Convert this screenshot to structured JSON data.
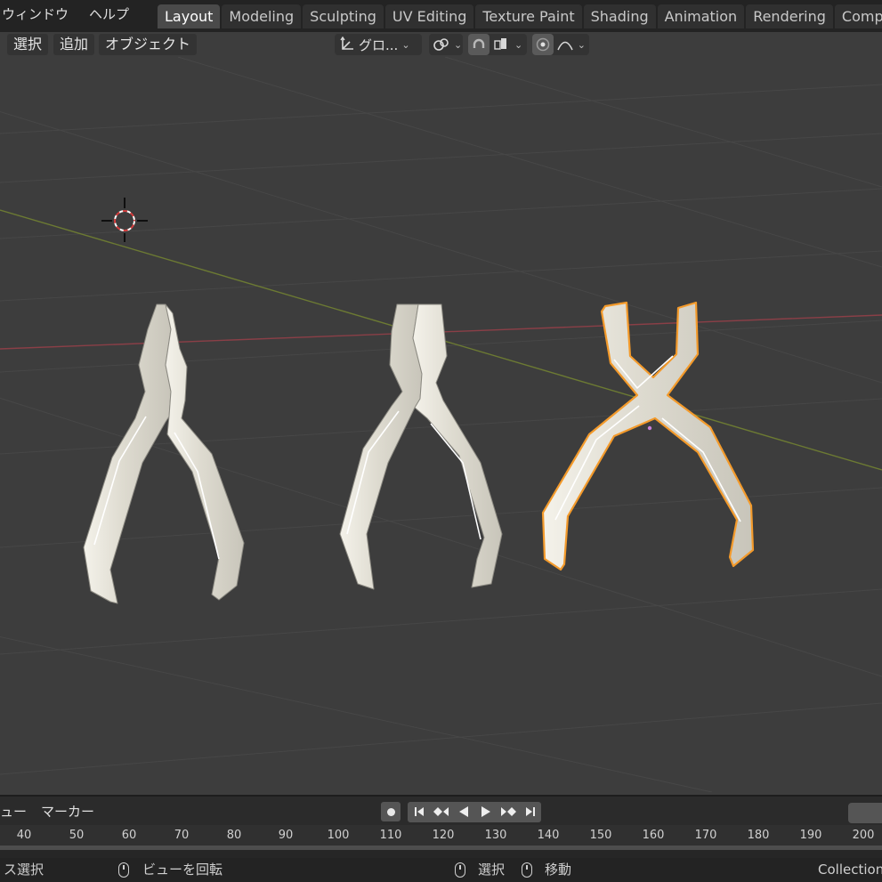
{
  "top_menu": {
    "window": "ウィンドウ",
    "help": "ヘルプ"
  },
  "tabs": [
    "Layout",
    "Modeling",
    "Sculpting",
    "UV Editing",
    "Texture Paint",
    "Shading",
    "Animation",
    "Rendering",
    "Compo"
  ],
  "active_tab": "Layout",
  "header": {
    "select": "選択",
    "add": "追加",
    "object": "オブジェクト",
    "transform_orientation": "グロ..."
  },
  "timeline": {
    "view_menu": "ュー",
    "marker_menu": "マーカー",
    "frame_ticks": [
      "40",
      "50",
      "60",
      "70",
      "80",
      "90",
      "100",
      "110",
      "120",
      "130",
      "140",
      "150",
      "160",
      "170",
      "180",
      "190",
      "200"
    ]
  },
  "statusbar": {
    "box_select": "ス選択",
    "rotate_view": "ビューを回転",
    "select": "選択",
    "move": "移動",
    "collection": "Collection"
  },
  "colors": {
    "selection_outline": "#f39a2b",
    "x_axis": "#8a3f47",
    "y_axis": "#6c7a33",
    "mesh": "#e6e3d8"
  }
}
